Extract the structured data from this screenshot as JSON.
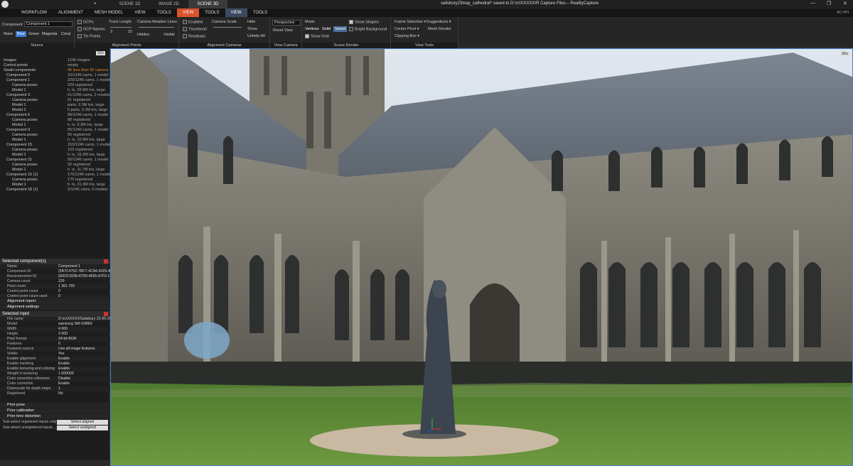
{
  "window": {
    "tabs": [
      "SCENE 1D",
      "IMAGE 2D",
      "SCENE 3D"
    ],
    "active_tab": 2,
    "title": "salisbury23may_cathedral* saved to D:\\rc\\XXXXX\\R Capture Files – RealityCapture",
    "controls": [
      "—",
      "❐",
      "✕"
    ]
  },
  "menu": {
    "items": [
      "WORKFLOW",
      "ALIGNMENT",
      "MESH MODEL",
      "VIEW",
      "TOOLS",
      "VIEW",
      "TOOLS",
      "VIEW",
      "TOOLS"
    ],
    "user": "RC PPI"
  },
  "ribbon": {
    "component_label": "Component",
    "component_value": "Component 1",
    "colors": [
      "None",
      "Blue",
      "Green",
      "Magenta",
      "Coral"
    ],
    "selected_color": "Blue",
    "source_label": "Source",
    "gcps": "GCPs",
    "gcp_names": "GCP Names",
    "tie_points": "Tie Points",
    "track_length": "Track Length",
    "tl_min": "3",
    "tl_max": "15",
    "camera_relation_lines": "Camera Relation Lines",
    "hidden": "Hidden",
    "visible": "Visible",
    "alignment_points_label": "Alignment Points",
    "enabled": "Enabled",
    "thumbnail": "Thumbnail",
    "residuals": "Residuals",
    "camera_scale": "Camera Scale",
    "alignment_cameras_label": "Alignment Cameras",
    "hide": "Hide",
    "show": "Show",
    "unhide_all": "Unhide All",
    "projection": "Perspective",
    "reset_view": "Reset View",
    "view_camera_label": "View Camera",
    "mode": "Mode",
    "vertices": "Vertices",
    "solid": "Solid",
    "sweet": "Sweet",
    "show_grid": "Show Grid",
    "show_shapes": "Show Shapes",
    "bright_background": "Bright Background",
    "scene_render_label": "Scene Render",
    "frame_selection": "Frame Selection",
    "suggestions": "Suggestions",
    "center_pivot": "Center Pivot",
    "mesh_render": "Mesh Render",
    "clipping_box": "Clipping Box",
    "view_tools_label": "View Tools"
  },
  "tree": {
    "badge": "1Dx",
    "rows": [
      {
        "name": "Images",
        "value": "1246 images"
      },
      {
        "name": "Control points",
        "value": "empty"
      },
      {
        "name": "Small components",
        "value": "45 less than 30 camera",
        "warn": true
      },
      {
        "name": "Component 0",
        "value": "16/1246 cams, 1 model"
      },
      {
        "name": "Component 1",
        "value": "229/1246 cams, 1 model"
      },
      {
        "name": "Camera poses",
        "value": "229 registered"
      },
      {
        "name": "Model 1",
        "value": "h. ts, 29.9M tris, large"
      },
      {
        "name": "Component 3",
        "value": "61/1246 cams, 2 models"
      },
      {
        "name": "Camera poses",
        "value": "61 registered"
      },
      {
        "name": "Model 1",
        "value": "parts, 9.3M tris, large"
      },
      {
        "name": "Model 2",
        "value": "0 parts, 9.3M tris, large"
      },
      {
        "name": "Component 6",
        "value": "88/1246 cams, 1 model"
      },
      {
        "name": "Camera poses",
        "value": "88 registered"
      },
      {
        "name": "Model 1",
        "value": "h. ts, 9.3M tris, large"
      },
      {
        "name": "Component 9",
        "value": "55/1246 cams, 1 model"
      },
      {
        "name": "Camera poses",
        "value": "55 registered"
      },
      {
        "name": "Model 1",
        "value": "h. ts, 10.9M tris, large"
      },
      {
        "name": "Component 15",
        "value": "153/1246 cams, 1 model"
      },
      {
        "name": "Camera poses",
        "value": "153 registered"
      },
      {
        "name": "Model 1",
        "value": "h. ts, 15.2M tris, large"
      },
      {
        "name": "Component 21",
        "value": "92/1246 cams, 1 model"
      },
      {
        "name": "Camera poses",
        "value": "92 registered"
      },
      {
        "name": "Model 1",
        "value": "h. ts, 11.7M tris, large"
      },
      {
        "name": "Component 15 (1)",
        "value": "170/1246 cams, 1 model"
      },
      {
        "name": "Camera poses",
        "value": "170 registered"
      },
      {
        "name": "Model 1",
        "value": "h. ts, 21.3M tris, large"
      },
      {
        "name": "Component 18 (1)",
        "value": "2/1246 cams, 0 models"
      }
    ]
  },
  "selected_component": {
    "header": "Selected component(s)",
    "rows": [
      {
        "k": "Name",
        "v": "Component 1"
      },
      {
        "k": "Component ID",
        "v": "{5B7C4752-7BF7-4C6A-9029-A..."
      },
      {
        "k": "Reconstruction ID",
        "v": "{D0CF2038-47D6-4655-87F0-1..."
      },
      {
        "k": "Camera count",
        "v": "229"
      },
      {
        "k": "Point count",
        "v": "1 361 765"
      },
      {
        "k": "Control point count",
        "v": "0"
      },
      {
        "k": "Control point count used",
        "v": "0"
      }
    ],
    "alignment_report": "Alignment report",
    "alignment_settings": "Alignment settings"
  },
  "selected_input": {
    "header": "Selected input",
    "rows": [
      {
        "k": "File name",
        "v": "D:\\rc\\XXXXX\\Salisbury 22-05-20..."
      },
      {
        "k": "Model",
        "v": "samsung SM-G9860"
      },
      {
        "k": "Width",
        "v": "4 000"
      },
      {
        "k": "Height",
        "v": "3 000"
      },
      {
        "k": "Pixel format",
        "v": "24-bit BGR"
      },
      {
        "k": "Features",
        "v": "0"
      },
      {
        "k": "Features source",
        "v": "Use all image features"
      },
      {
        "k": "Visible",
        "v": "Yes"
      },
      {
        "k": "Enable alignment",
        "v": "Enable"
      },
      {
        "k": "Enable meshing",
        "v": "Enable"
      },
      {
        "k": "Enable texturing and coloring",
        "v": "Enable"
      },
      {
        "k": "Weight in texturing",
        "v": "1.000000"
      },
      {
        "k": "Color correction reference",
        "v": "Disable"
      },
      {
        "k": "Color correction",
        "v": "Enable"
      },
      {
        "k": "Downscale for depth maps",
        "v": "1"
      },
      {
        "k": "Registered",
        "v": "No"
      }
    ],
    "prior_pose": "Prior pose",
    "prior_calibration": "Prior calibration",
    "prior_lens_distortion": "Prior lens distortion",
    "sub_registered_label": "Sub-select registered inputs only",
    "sub_registered_btn": "Select aligned",
    "sub_unregistered_label": "Sub-select unregistered inputs ...",
    "sub_unregistered_btn": "Select unaligned"
  },
  "viewport": {
    "badge": "3Dx"
  }
}
